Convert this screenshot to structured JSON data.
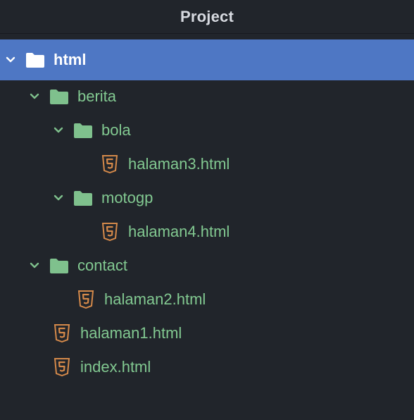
{
  "header": {
    "title": "Project"
  },
  "colors": {
    "selection": "#4e77c4",
    "folder": "#7fc18d",
    "label": "#82c991",
    "html5_icon": "#d4894a",
    "background": "#21252b"
  },
  "tree": {
    "root": {
      "label": "html",
      "icon": "folder-icon",
      "expanded": true
    },
    "berita": {
      "label": "berita",
      "icon": "folder-icon",
      "expanded": true
    },
    "bola": {
      "label": "bola",
      "icon": "folder-icon",
      "expanded": true
    },
    "halaman3": {
      "label": "halaman3.html",
      "icon": "html5-icon"
    },
    "motogp": {
      "label": "motogp",
      "icon": "folder-icon",
      "expanded": true
    },
    "halaman4": {
      "label": "halaman4.html",
      "icon": "html5-icon"
    },
    "contact": {
      "label": "contact",
      "icon": "folder-icon",
      "expanded": true
    },
    "halaman2": {
      "label": "halaman2.html",
      "icon": "html5-icon"
    },
    "halaman1": {
      "label": "halaman1.html",
      "icon": "html5-icon"
    },
    "index": {
      "label": "index.html",
      "icon": "html5-icon"
    }
  }
}
